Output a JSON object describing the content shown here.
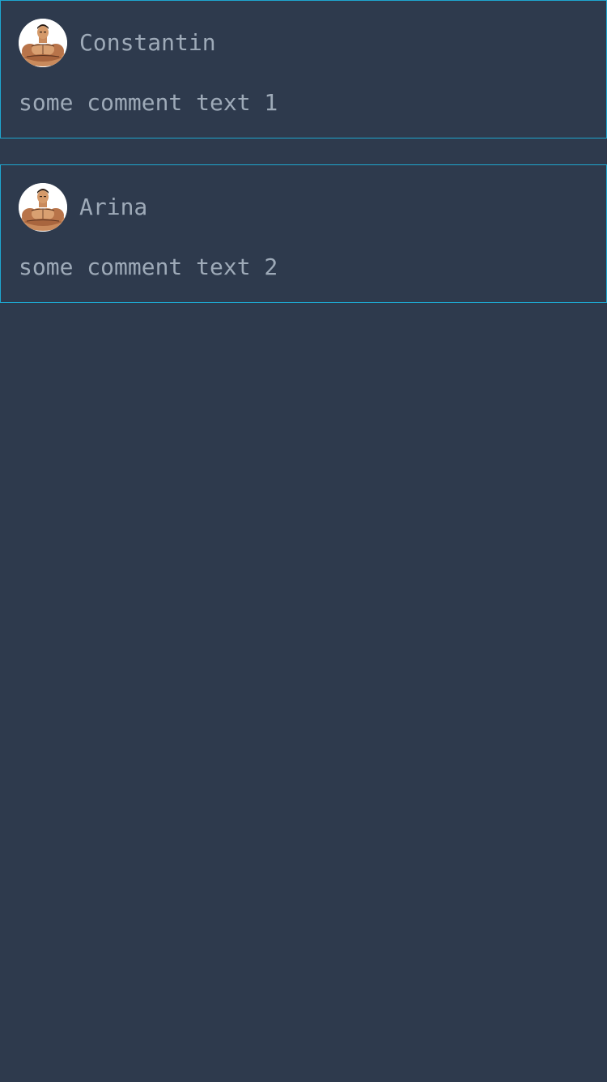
{
  "colors": {
    "background": "#2e3a4d",
    "card_border": "#1ea6cf",
    "text": "#9eaab8"
  },
  "comments": [
    {
      "author": "Constantin",
      "avatar_icon": "bodybuilder-avatar-icon",
      "text": "some comment text 1"
    },
    {
      "author": "Arina",
      "avatar_icon": "bodybuilder-avatar-icon",
      "text": "some comment text 2"
    }
  ]
}
